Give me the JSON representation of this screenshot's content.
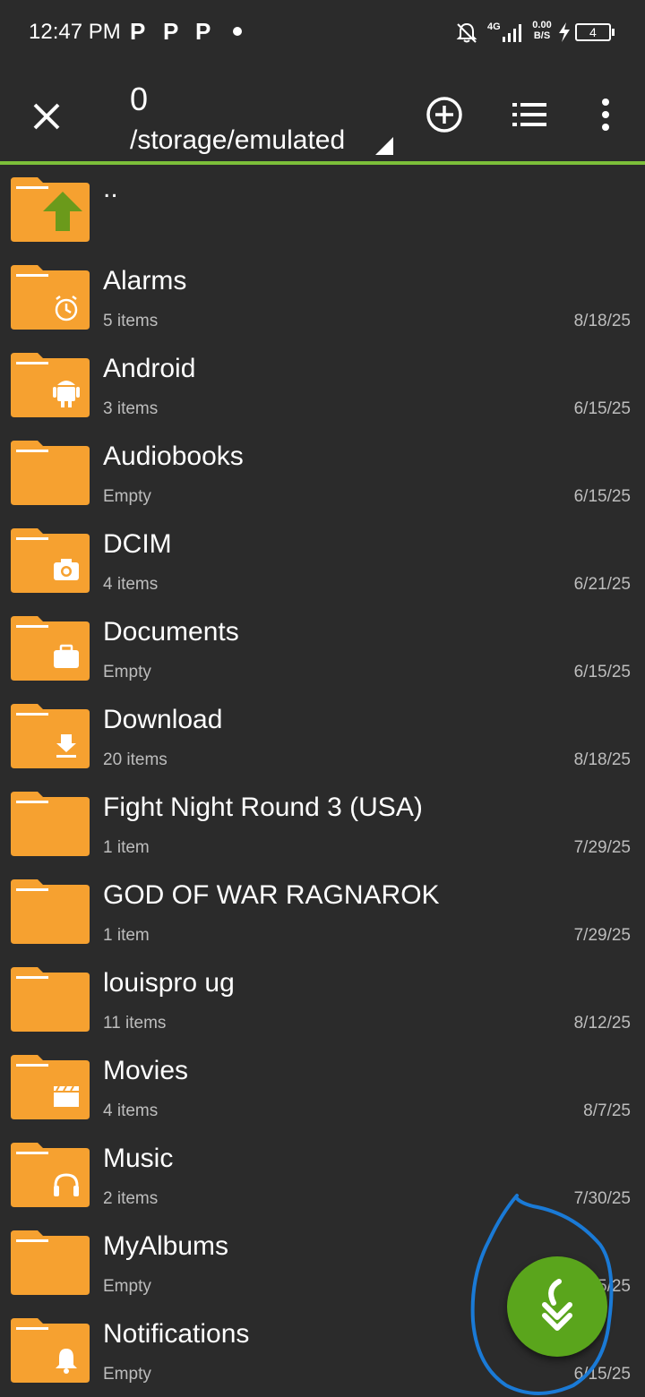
{
  "status_bar": {
    "time": "12:47 PM",
    "notifications": [
      "P",
      "P",
      "P"
    ],
    "network_type": "4G",
    "data_rate_value": "0.00",
    "data_rate_unit": "B/S",
    "battery": "4",
    "icons": [
      "mute-bell-icon",
      "signal-icon",
      "charging-icon",
      "battery-icon"
    ]
  },
  "toolbar": {
    "count": "0",
    "path": "/storage/emulated",
    "icons": [
      "close-icon",
      "add-circle-icon",
      "list-view-icon",
      "more-vert-icon"
    ]
  },
  "colors": {
    "background": "#2b2b2b",
    "accent": "#7cbf3a",
    "folder": "#f6a130",
    "fab": "#5aa51c",
    "annotation": "#1a7ad6"
  },
  "files": {
    "parent": {
      "name": "..",
      "icon": "up-arrow-icon"
    },
    "items": [
      {
        "name": "Alarms",
        "sub": "5 items",
        "date": "8/18/25",
        "icon": "alarm-icon"
      },
      {
        "name": "Android",
        "sub": "3 items",
        "date": "6/15/25",
        "icon": "android-icon"
      },
      {
        "name": "Audiobooks",
        "sub": "Empty",
        "date": "6/15/25",
        "icon": "none"
      },
      {
        "name": "DCIM",
        "sub": "4 items",
        "date": "6/21/25",
        "icon": "camera-icon"
      },
      {
        "name": "Documents",
        "sub": "Empty",
        "date": "6/15/25",
        "icon": "briefcase-icon"
      },
      {
        "name": "Download",
        "sub": "20 items",
        "date": "8/18/25",
        "icon": "download-icon"
      },
      {
        "name": "Fight Night Round 3 (USA)",
        "sub": "1 item",
        "date": "7/29/25",
        "icon": "none"
      },
      {
        "name": "GOD OF WAR RAGNAROK",
        "sub": "1 item",
        "date": "7/29/25",
        "icon": "none"
      },
      {
        "name": "louispro ug",
        "sub": "11 items",
        "date": "8/12/25",
        "icon": "none"
      },
      {
        "name": "Movies",
        "sub": "4 items",
        "date": "8/7/25",
        "icon": "clapperboard-icon"
      },
      {
        "name": "Music",
        "sub": "2 items",
        "date": "7/30/25",
        "icon": "headphones-icon"
      },
      {
        "name": "MyAlbums",
        "sub": "Empty",
        "date": "7/25/25",
        "icon": "none"
      },
      {
        "name": "Notifications",
        "sub": "Empty",
        "date": "6/15/25",
        "icon": "bell-icon"
      }
    ]
  },
  "fab": {
    "icon": "double-down-arrow-icon"
  }
}
